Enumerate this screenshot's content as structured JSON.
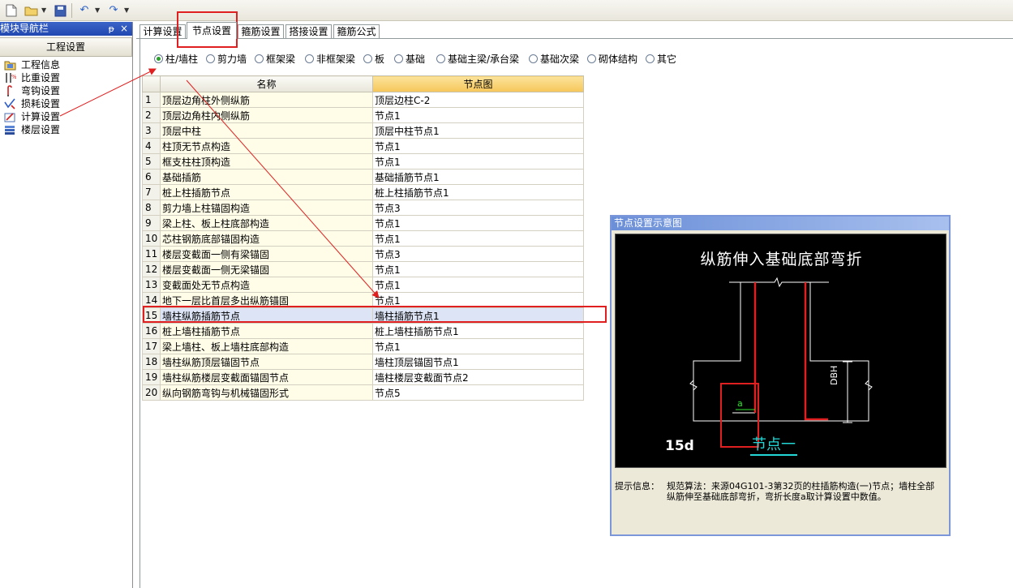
{
  "toolbar": {
    "buttons": [
      {
        "name": "new-file-icon"
      },
      {
        "name": "open-folder-icon"
      },
      {
        "name": "save-icon"
      },
      {
        "name": "undo-icon"
      },
      {
        "name": "redo-icon"
      }
    ]
  },
  "nav": {
    "title": "模块导航栏",
    "pin": "ᵽ",
    "close": "×",
    "header": "工程设置",
    "items": [
      {
        "label": "工程信息"
      },
      {
        "label": "比重设置"
      },
      {
        "label": "弯钩设置"
      },
      {
        "label": "损耗设置"
      },
      {
        "label": "计算设置"
      },
      {
        "label": "楼层设置"
      }
    ]
  },
  "tabs": [
    {
      "label": "计算设置"
    },
    {
      "label": "节点设置"
    },
    {
      "label": "箍筋设置"
    },
    {
      "label": "搭接设置"
    },
    {
      "label": "箍筋公式"
    }
  ],
  "radios": [
    {
      "label": "柱/墙柱",
      "checked": true
    },
    {
      "label": "剪力墙"
    },
    {
      "label": "框架梁"
    },
    {
      "label": "非框架梁"
    },
    {
      "label": "板"
    },
    {
      "label": "基础"
    },
    {
      "label": "基础主梁/承台梁"
    },
    {
      "label": "基础次梁"
    },
    {
      "label": "砌体结构"
    },
    {
      "label": "其它"
    }
  ],
  "grid": {
    "columns": [
      "名称",
      "节点图"
    ],
    "rows": [
      {
        "no": "1",
        "name": "顶层边角柱外侧纵筋",
        "node": "顶层边柱C-2"
      },
      {
        "no": "2",
        "name": "顶层边角柱内侧纵筋",
        "node": "节点1"
      },
      {
        "no": "3",
        "name": "顶层中柱",
        "node": "顶层中柱节点1"
      },
      {
        "no": "4",
        "name": "柱顶无节点构造",
        "node": "节点1"
      },
      {
        "no": "5",
        "name": "框支柱柱顶构造",
        "node": "节点1"
      },
      {
        "no": "6",
        "name": "基础插筋",
        "node": "基础插筋节点1"
      },
      {
        "no": "7",
        "name": "桩上柱插筋节点",
        "node": "桩上柱插筋节点1"
      },
      {
        "no": "8",
        "name": "剪力墙上柱锚固构造",
        "node": "节点3"
      },
      {
        "no": "9",
        "name": "梁上柱、板上柱底部构造",
        "node": "节点1"
      },
      {
        "no": "10",
        "name": "芯柱钢筋底部锚固构造",
        "node": "节点1"
      },
      {
        "no": "11",
        "name": "楼层变截面一侧有梁锚固",
        "node": "节点3"
      },
      {
        "no": "12",
        "name": "楼层变截面一侧无梁锚固",
        "node": "节点1"
      },
      {
        "no": "13",
        "name": "变截面处无节点构造",
        "node": "节点1"
      },
      {
        "no": "14",
        "name": "地下一层比首层多出纵筋锚固",
        "node": "节点1"
      },
      {
        "no": "15",
        "name": "墙柱纵筋插筋节点",
        "node": "墙柱插筋节点1"
      },
      {
        "no": "16",
        "name": "桩上墙柱插筋节点",
        "node": "桩上墙柱插筋节点1"
      },
      {
        "no": "17",
        "name": "梁上墙柱、板上墙柱底部构造",
        "node": "节点1"
      },
      {
        "no": "18",
        "name": "墙柱纵筋顶层锚固节点",
        "node": "墙柱顶层锚固节点1"
      },
      {
        "no": "19",
        "name": "墙柱纵筋楼层变截面锚固节点",
        "node": "墙柱楼层变截面节点2"
      },
      {
        "no": "20",
        "name": "纵向钢筋弯钩与机械锚固形式",
        "node": "节点5"
      }
    ]
  },
  "panel": {
    "title": "节点设置示意图",
    "canvas_title": "纵筋伸入基础底部弯折",
    "label_15d": "15d",
    "label_node": "节点一",
    "label_a": "a",
    "label_dbh": "DBH",
    "hint_label": "提示信息：",
    "hint_text": "规范算法：来源04G101-3第32页的柱插筋构造(一)节点；墙柱全部纵筋伸至基础底部弯折，弯折长度a取计算设置中数值。"
  },
  "colors": {
    "annotation": "#e02020",
    "nav_title": "#2148b0",
    "header_highlight": "#f6c65a",
    "canvas_bg": "#000000",
    "rebar": "#e02020",
    "node_label": "#23d7d7"
  }
}
